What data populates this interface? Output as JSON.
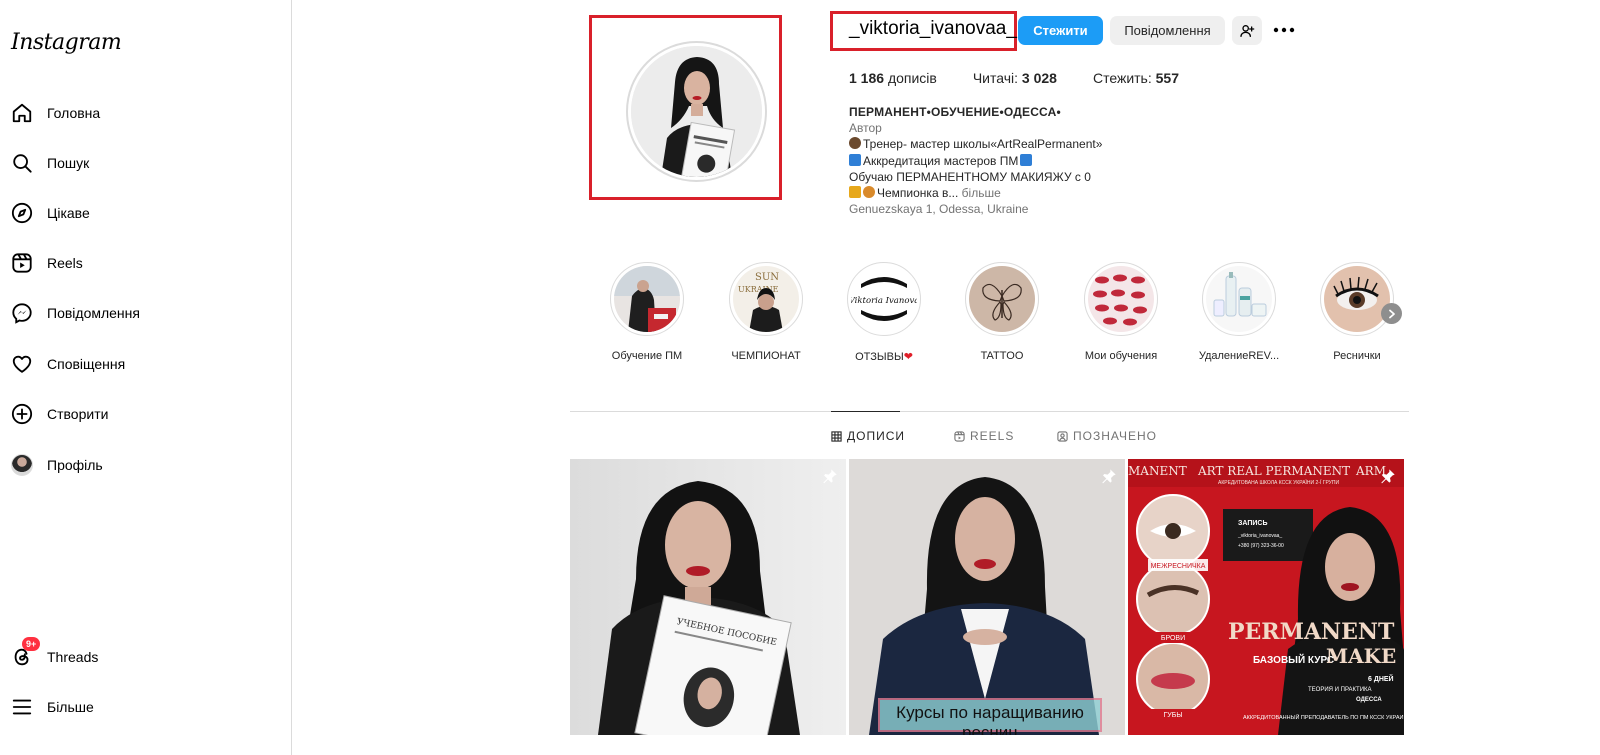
{
  "sidebar": {
    "logo": "Instagram",
    "items": [
      {
        "label": "Головна",
        "icon": "home-icon"
      },
      {
        "label": "Пошук",
        "icon": "search-icon"
      },
      {
        "label": "Цікаве",
        "icon": "explore-icon"
      },
      {
        "label": "Reels",
        "icon": "reels-icon"
      },
      {
        "label": "Повідомлення",
        "icon": "messenger-icon"
      },
      {
        "label": "Сповіщення",
        "icon": "heart-icon"
      },
      {
        "label": "Створити",
        "icon": "plus-square-icon"
      },
      {
        "label": "Профіль",
        "icon": "avatar"
      }
    ],
    "threads": {
      "label": "Threads",
      "badge": "9+",
      "icon": "threads-icon"
    },
    "more": {
      "label": "Більше",
      "icon": "menu-icon"
    }
  },
  "profile": {
    "username": "_viktoria_ivanovaa_",
    "follow_label": "Стежити",
    "message_label": "Повідомлення",
    "stats": {
      "posts_count": "1 186",
      "posts_label": "дописів",
      "followers_label": "Читачі:",
      "followers_count": "3 028",
      "following_label": "Стежить:",
      "following_count": "557"
    },
    "bio": {
      "name": "ПЕРМАНЕНТ•ОБУЧЕНИЕ•ОДЕССА•",
      "category": "Автор",
      "line1": "Тренер- мастер школы«ArtRealPermanent»",
      "line2": "Аккредитация мастеров ПМ",
      "line3": "Обучаю ПЕРМАНЕНТНОМУ МАКИЯЖУ с 0",
      "line4": "Чемпионка в...",
      "more": "більше",
      "location": "Genuezskaya 1, Odessa, Ukraine"
    }
  },
  "highlights": [
    {
      "title": "Обучение ПМ"
    },
    {
      "title": "ЧЕМПИОНАТ"
    },
    {
      "title": "ОТЗЫВЫ"
    },
    {
      "title": "TATTOO"
    },
    {
      "title": "Мои обучения"
    },
    {
      "title": "УдалениеREV..."
    },
    {
      "title": "Реснички"
    }
  ],
  "highlight_texts": {
    "sun": "SUN",
    "ukraine": "UKRAINE",
    "logo_script": "Viktoria Ivanova"
  },
  "tabs": [
    {
      "label": "ДОПИСИ",
      "icon": "grid-icon",
      "active": true
    },
    {
      "label": "REELS",
      "icon": "reels-icon",
      "active": false
    },
    {
      "label": "ПОЗНАЧЕНО",
      "icon": "tagged-icon",
      "active": false
    }
  ],
  "posts": {
    "post1": {
      "pinned": true,
      "booklet": "УЧЕБНОЕ ПОСОБИЕ"
    },
    "post2": {
      "pinned": true,
      "caption": "Курсы по наращиванию ресниц"
    },
    "post3": {
      "pinned": true,
      "banner": "ART REAL PERMANENT",
      "banner_left": "MANENT",
      "banner_right": "ARM",
      "accreditation": "АКРЕДИТОВАНА ШКОЛА КССК УКРАЇНИ 2-Ї ГРУПИ",
      "label_lashes": "МЕЖРЕСНИЧКА",
      "label_brows": "БРОВИ",
      "label_lips": "ГУБЫ",
      "record": "ЗАПИСЬ",
      "handle": "_viktoria_ivanovaa_",
      "phone": "+380 (97) 323-36-00",
      "big1": "PERMANENT",
      "big2": "MAKE UP",
      "base": "БАЗОВЫЙ КУРС",
      "days": "6 ДНЕЙ",
      "theory": "ТЕОРИЯ И ПРАКТИКА",
      "city": "ОДЕССА",
      "teacher": "АККРЕДИТОВАННЫЙ ПРЕПОДАВАТЕЛЬ ПО ПМ КССК УКРАИНЫ"
    }
  },
  "colors": {
    "follow_blue": "#1c9cf6",
    "highlight_red": "#d9202a",
    "badge_red": "#ff3040",
    "border": "#dbdbdb"
  }
}
